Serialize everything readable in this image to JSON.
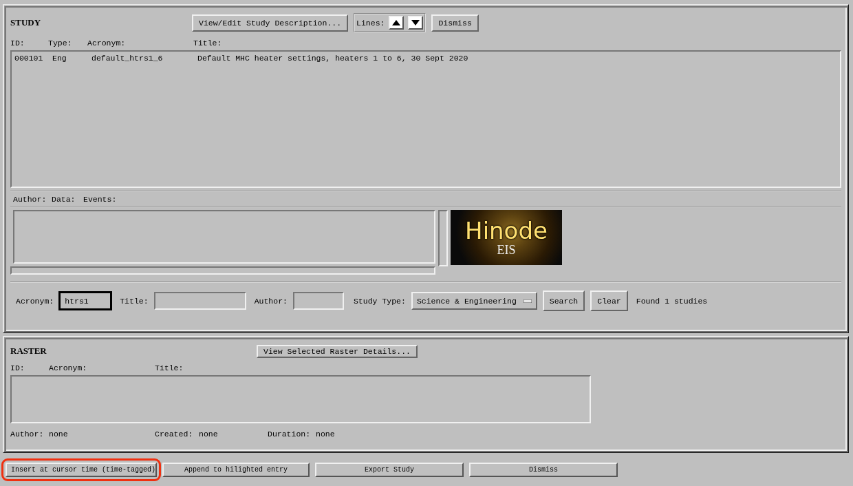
{
  "study": {
    "title": "STUDY",
    "describe_button": "View/Edit Study Description...",
    "lines_label": "Lines:",
    "dismiss_button": "Dismiss",
    "columns": [
      "ID:",
      "Type:",
      "Acronym:",
      "Title:"
    ],
    "rows": [
      {
        "cells": [
          "000101",
          "Eng",
          "default_htrs1_6",
          "Default MHC heater settings, heaters 1 to 6, 30 Sept 2020"
        ],
        "selected": false
      }
    ],
    "info_labels": [
      "Author:",
      "Data:",
      "Events:"
    ],
    "logo": {
      "main": "Hinode",
      "sub": "EIS"
    },
    "search": {
      "acronym_label": "Acronym:",
      "acronym_value": "htrs1",
      "acronym_focused": true,
      "title_label": "Title:",
      "author_label": "Author:",
      "type_label": "Study Type:",
      "type_value": "Science & Engineering",
      "search_button": "Search",
      "clear_button": "Clear",
      "status": "Found 1 studies"
    }
  },
  "raster": {
    "title": "RASTER",
    "details_button": "View Selected Raster Details...",
    "columns": [
      "ID:",
      "Acronym:",
      "Title:"
    ],
    "info": [
      {
        "label": "Author:",
        "value": "none"
      },
      {
        "label": "Created:",
        "value": "none"
      },
      {
        "label": "Duration:",
        "value": "none"
      }
    ]
  },
  "actions": [
    {
      "label": "Insert at cursor time (time-tagged)",
      "circled": true
    },
    {
      "label": "Append to hilighted entry",
      "circled": false
    },
    {
      "label": "Export Study",
      "circled": false
    },
    {
      "label": "Dismiss",
      "circled": false
    }
  ]
}
